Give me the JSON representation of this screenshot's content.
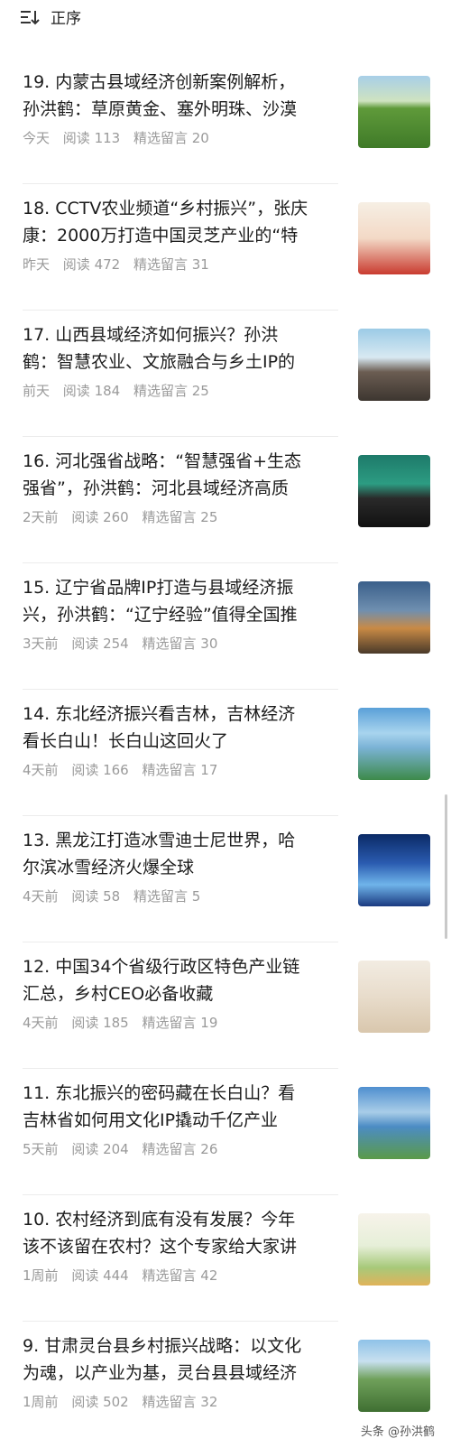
{
  "header": {
    "sort_label": "正序",
    "sort_icon": "sort-icon"
  },
  "items": [
    {
      "title1": "19. 内蒙古县域经济创新案例解析，",
      "title2": "孙洪鹤：草原黄金、塞外明珠、沙漠",
      "time": "今天",
      "reads": "阅读 113",
      "comments": "精选留言 20",
      "thumb": "grassland-image"
    },
    {
      "title1": "18. CCTV农业频道“乡村振兴”，张庆",
      "title2": "康：2000万打造中国灵芝产业的“特",
      "time": "昨天",
      "reads": "阅读 472",
      "comments": "精选留言 31",
      "thumb": "stage-image"
    },
    {
      "title1": "17. 山西县域经济如何振兴？孙洪",
      "title2": "鹤：智慧农业、文旅融合与乡土IP的",
      "time": "前天",
      "reads": "阅读 184",
      "comments": "精选留言 25",
      "thumb": "village-image"
    },
    {
      "title1": "16. 河北强省战略：“智慧强省+生态",
      "title2": "强省”，孙洪鹤：河北县域经济高质",
      "time": "2天前",
      "reads": "阅读 260",
      "comments": "精选留言 25",
      "thumb": "conference-image"
    },
    {
      "title1": "15. 辽宁省品牌IP打造与县域经济振",
      "title2": "兴，孙洪鹤：“辽宁经验”值得全国推",
      "time": "3天前",
      "reads": "阅读 254",
      "comments": "精选留言 30",
      "thumb": "city-image"
    },
    {
      "title1": "14. 东北经济振兴看吉林，吉林经济",
      "title2": "看长白山！长白山这回火了",
      "time": "4天前",
      "reads": "阅读 166",
      "comments": "精选留言 17",
      "thumb": "lake-image"
    },
    {
      "title1": "13. 黑龙江打造冰雪迪士尼世界，哈",
      "title2": "尔滨冰雪经济火爆全球",
      "time": "4天前",
      "reads": "阅读 58",
      "comments": "精选留言 5",
      "thumb": "ice-festival-image"
    },
    {
      "title1": "12. 中国34个省级行政区特色产业链",
      "title2": "汇总，乡村CEO必备收藏",
      "time": "4天前",
      "reads": "阅读 185",
      "comments": "精选留言 19",
      "thumb": "certificate-image"
    },
    {
      "title1": "11. 东北振兴的密码藏在长白山？看",
      "title2": "吉林省如何用文化IP撬动千亿产业",
      "time": "5天前",
      "reads": "阅读 204",
      "comments": "精选留言 26",
      "thumb": "mountain-lake-image"
    },
    {
      "title1": "10. 农村经济到底有没有发展？今年",
      "title2": "该不该留在农村？这个专家给大家讲",
      "time": "1周前",
      "reads": "阅读 444",
      "comments": "精选留言 42",
      "thumb": "cartoon-image"
    },
    {
      "title1": "9. 甘肃灵台县乡村振兴战略：以文化",
      "title2": "为魂，以产业为基，灵台县县域经济",
      "time": "1周前",
      "reads": "阅读 502",
      "comments": "精选留言 32",
      "thumb": "park-image"
    }
  ],
  "watermark": "头条 @孙洪鹤"
}
